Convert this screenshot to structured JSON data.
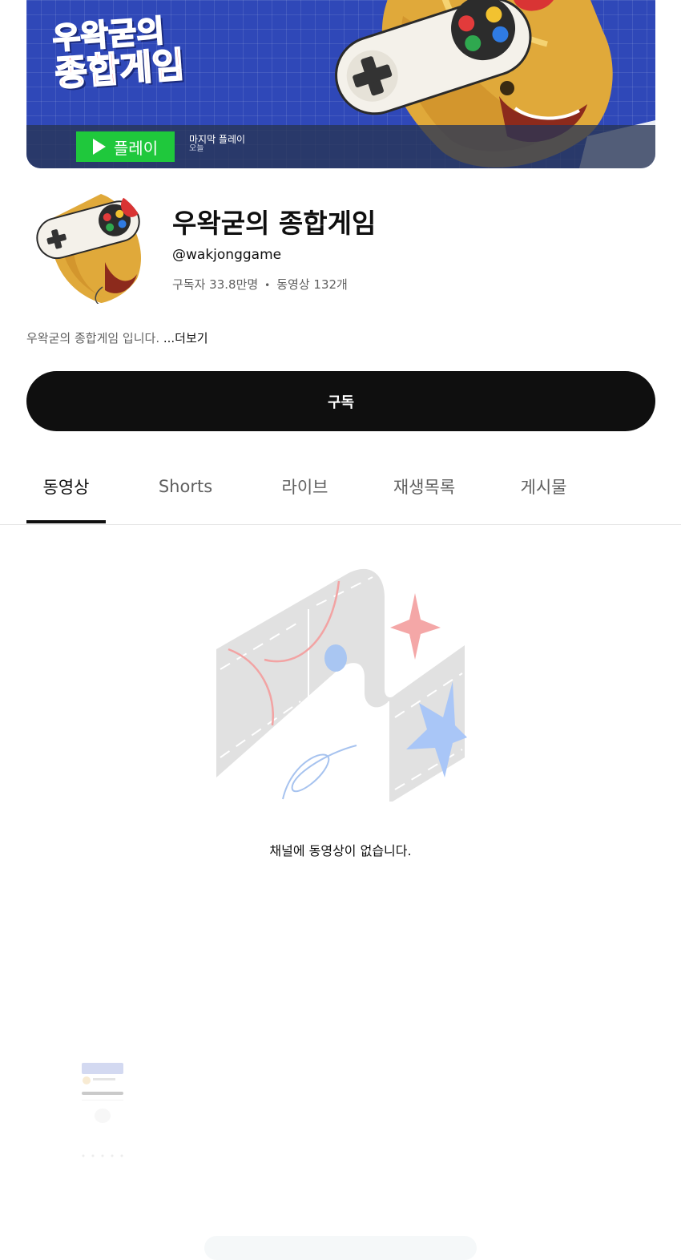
{
  "banner": {
    "logo_line1": "우왁굳의",
    "logo_line2": "종합게임",
    "play_label": "플레이",
    "last_play_label": "마지막 플레이",
    "last_play_value": "오늘"
  },
  "channel": {
    "title": "우왁굳의 종합게임",
    "handle": "@wakjonggame",
    "subscribers": "구독자 33.8만명",
    "separator": "•",
    "videos": "동영상 132개",
    "description": "우왁굳의 종합게임 입니다. ",
    "more_label": "...더보기"
  },
  "subscribe": {
    "label": "구독"
  },
  "tabs": [
    {
      "label": "동영상"
    },
    {
      "label": "Shorts"
    },
    {
      "label": "라이브"
    },
    {
      "label": "재생목록"
    },
    {
      "label": "게시물"
    }
  ],
  "empty_state": {
    "message": "채널에 동영상이 없습니다."
  },
  "colors": {
    "banner_blue": "#2f48b8",
    "play_green": "#1fc83c",
    "subscribe_black": "#0f0f0f",
    "muted_text": "#606060"
  },
  "icons": {
    "banner_art": "game-controller-character",
    "play": "play-icon"
  }
}
